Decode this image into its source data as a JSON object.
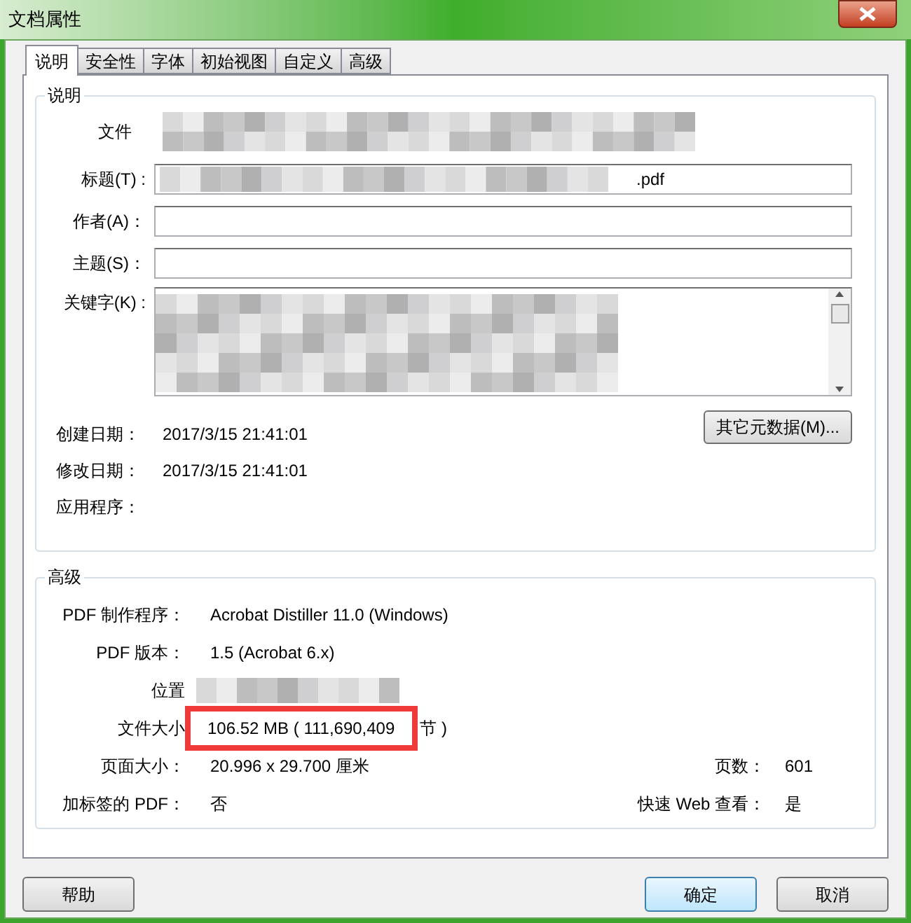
{
  "window": {
    "title": "文档属性"
  },
  "tabs": [
    {
      "label": "说明",
      "selected": true
    },
    {
      "label": "安全性",
      "selected": false
    },
    {
      "label": "字体",
      "selected": false
    },
    {
      "label": "初始视图",
      "selected": false
    },
    {
      "label": "自定义",
      "selected": false
    },
    {
      "label": "高级",
      "selected": false
    }
  ],
  "description": {
    "title": "说明",
    "file_label": "文件",
    "fields": [
      {
        "kind": "input",
        "label": "标题(T) :",
        "value": ".pdf"
      },
      {
        "kind": "input",
        "label": "作者(A)："
      },
      {
        "kind": "input",
        "label": "主题(S)："
      },
      {
        "kind": "textarea",
        "label": "关键字(K) :"
      }
    ],
    "info": [
      {
        "label": "创建日期：",
        "value": "2017/3/15 21:41:01"
      },
      {
        "label": "修改日期：",
        "value": "2017/3/15 21:41:01"
      },
      {
        "label": "应用程序："
      }
    ],
    "more_button": "其它元数据(M)..."
  },
  "advanced": {
    "title": "高级",
    "rows": [
      {
        "label": "PDF 制作程序：",
        "value": "Acrobat Distiller 11.0 (Windows)"
      },
      {
        "label": "PDF 版本：",
        "value": "1.5 (Acrobat 6.x)"
      },
      {
        "label": "位置",
        "kind": "hidden"
      },
      {
        "label": "文件大小",
        "value": "106.52 MB ( 111,690,409",
        "suffix": "节 )",
        "highlighted": true
      },
      {
        "label": "页面大小：",
        "value": "20.996 x 29.700 厘米",
        "extra_label": "页数：",
        "extra_value": "601"
      },
      {
        "label": "加标签的 PDF：",
        "value": "否",
        "extra_label": "快速 Web 查看：",
        "extra_value": "是"
      }
    ]
  },
  "buttons": [
    {
      "label": "帮助",
      "default": false
    },
    {
      "label": "确定",
      "default": true
    },
    {
      "label": "取消",
      "default": false
    }
  ]
}
